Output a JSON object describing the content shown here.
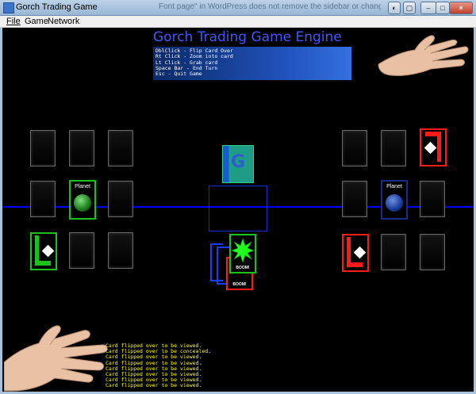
{
  "window": {
    "title": "Gorch Trading Game",
    "background_tab_text": "Font page\" in WordPress does not remove the sidebar or change the look of the re"
  },
  "menu": {
    "items": [
      {
        "label": "File"
      },
      {
        "label": "Game"
      },
      {
        "label": "Network"
      }
    ]
  },
  "engine": {
    "title": "Gorch Trading Game Engine",
    "help_lines": [
      "DblClick - Flip Card Over",
      "Rt Click - Zoom into card",
      "Lt Click - Grab card",
      "Space Bar - End Turn",
      "Esc - Quit Game"
    ]
  },
  "board": {
    "deck_letter": "G",
    "left_planet_label": "Planet",
    "right_planet_label": "Planet",
    "boom_label_top": "BOOM!",
    "boom_label_bottom": "BOOM!",
    "colors": {
      "line": "#0000ff",
      "player_left": "#1bc21b",
      "player_right": "#ff1a1a",
      "deck": "#1e9b86"
    }
  },
  "log": {
    "lines": [
      "Card flipped over to be viewed.",
      "Card flipped over to be concealed.",
      "Card flipped over to be viewed.",
      "Card flipped over to be viewed.",
      "Card flipped over to be viewed.",
      "Card flipped over to be viewed.",
      "Card flipped over to be viewed.",
      "Card flipped over to be viewed."
    ]
  }
}
